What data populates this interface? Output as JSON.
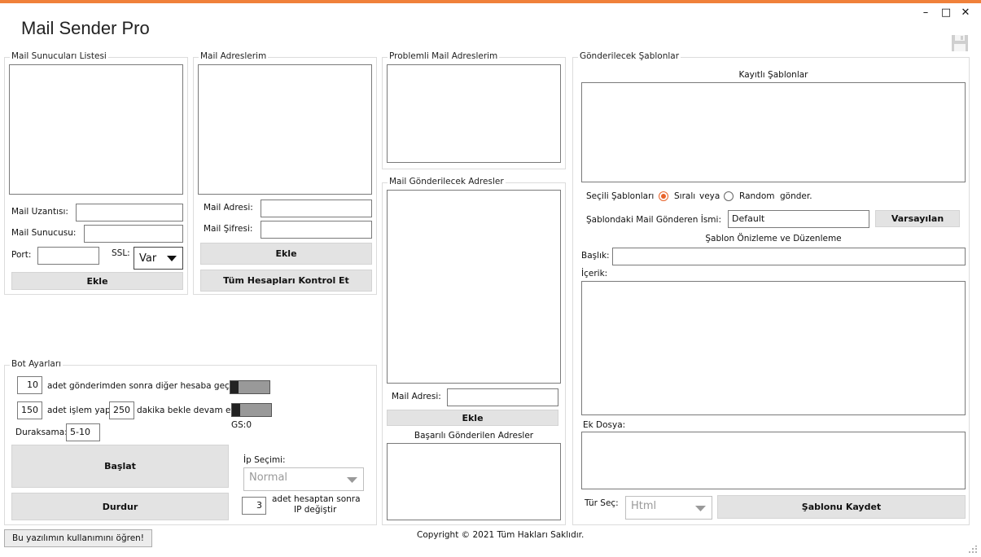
{
  "app": {
    "title": "Mail Sender Pro",
    "minimize": "–",
    "maximize": "□",
    "close": "✕"
  },
  "servers": {
    "title": "Mail Sunucuları Listesi",
    "ext_label": "Mail Uzantısı:",
    "server_label": "Mail Sunucusu:",
    "port_label": "Port:",
    "ssl_label": "SSL:",
    "ssl_value": "Var",
    "add": "Ekle"
  },
  "accounts": {
    "title": "Mail Adreslerim",
    "address_label": "Mail Adresi:",
    "password_label": "Mail Şifresi:",
    "add": "Ekle",
    "check_all": "Tüm Hesapları Kontrol Et"
  },
  "problem": {
    "title": "Problemli Mail Adreslerim"
  },
  "recipients": {
    "title": "Mail Gönderilecek Adresler",
    "address_label": "Mail Adresi:",
    "add": "Ekle",
    "success_title": "Başarılı Gönderilen Adresler"
  },
  "bot": {
    "title": "Bot Ayarları",
    "count1": "10",
    "text1": "adet gönderimden sonra diğer hesaba geç",
    "count2": "150",
    "text2a": "adet işlem yap",
    "minutes": "250",
    "text2b": "dakika bekle devam et",
    "gs": "GS:0",
    "pause_label": "Duraksama:",
    "pause_value": "5-10",
    "start": "Başlat",
    "stop": "Durdur",
    "ip_label": "İp Seçimi:",
    "ip_value": "Normal",
    "ip_count": "3",
    "ip_text1": "adet hesaptan sonra",
    "ip_text2": "IP değiştir"
  },
  "templates": {
    "title": "Gönderilecek Şablonlar",
    "saved_title": "Kayıtlı Şablonlar",
    "selected_label": "Seçili Şablonları",
    "ordered": "Sıralı",
    "or": "veya",
    "random": "Random",
    "send": "gönder.",
    "sender_label": "Şablondaki Mail Gönderen İsmi:",
    "sender_value": "Default",
    "default_btn": "Varsayılan",
    "preview_title": "Şablon Önizleme ve Düzenleme",
    "subject_label": "Başlık:",
    "content_label": "İçerik:",
    "attach_label": "Ek Dosya:",
    "type_label": "Tür Seç:",
    "type_value": "Html",
    "save": "Şablonu Kaydet"
  },
  "footer": {
    "help": "Bu yazılımın kullanımını öğren!",
    "copyright": "Copyright © 2021 Tüm Hakları Saklıdır."
  }
}
